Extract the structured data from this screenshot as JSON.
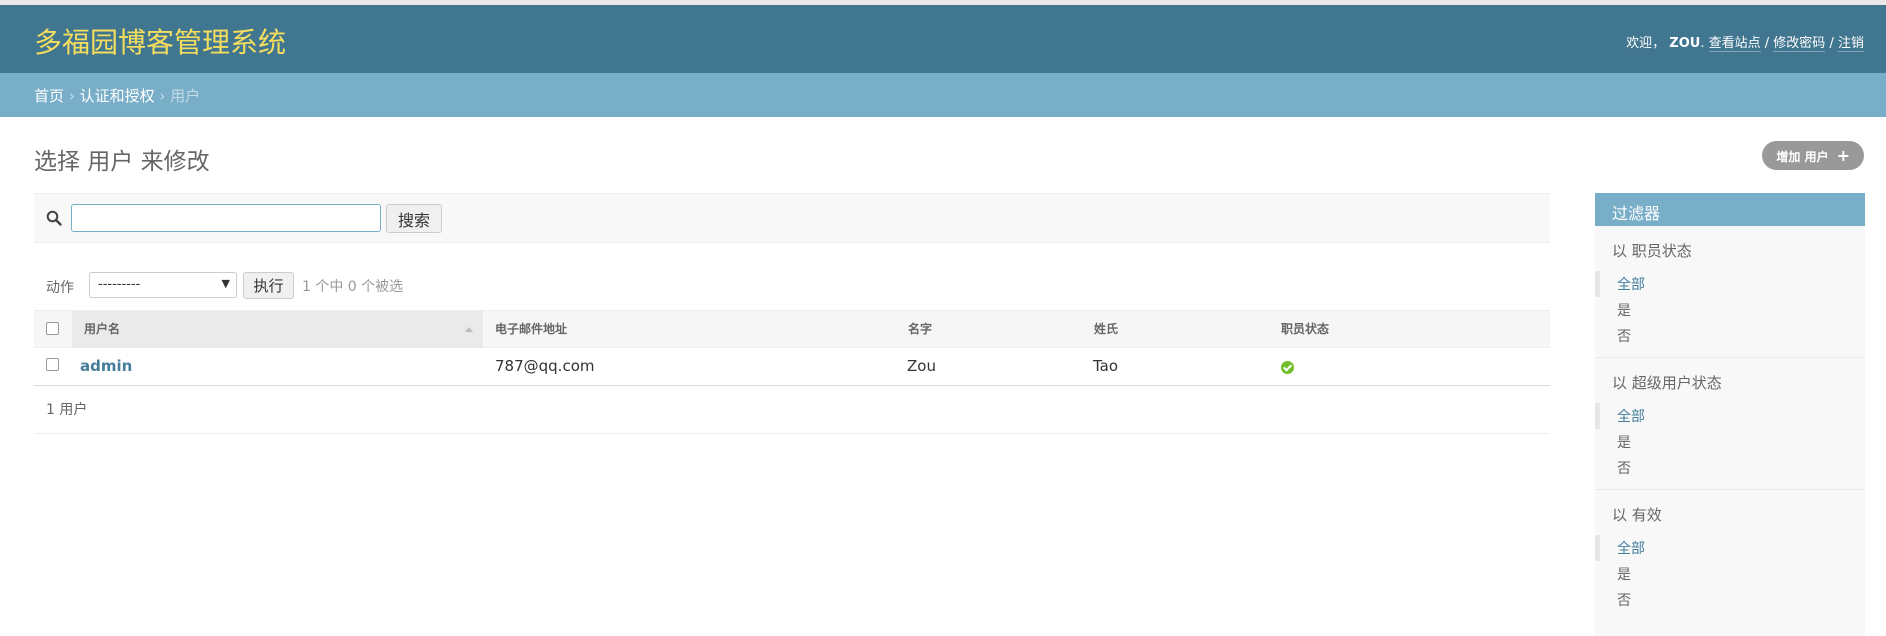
{
  "header": {
    "site_name": "多福园博客管理系统",
    "welcome": "欢迎，",
    "username": "ZOU",
    "view_site": "查看站点",
    "change_password": "修改密码",
    "logout": "注销",
    "sep": "/"
  },
  "breadcrumbs": {
    "home": "首页",
    "app": "认证和授权",
    "current": "用户",
    "sep": "›"
  },
  "page": {
    "title": "选择 用户 来修改",
    "add_button": "增加 用户",
    "add_icon": "+"
  },
  "search": {
    "value": "",
    "placeholder": "",
    "button": "搜索"
  },
  "actions": {
    "label": "动作",
    "selected": "---------",
    "go_button": "执行",
    "counter": "1 个中 0 个被选"
  },
  "table": {
    "headers": [
      "用户名",
      "电子邮件地址",
      "名字",
      "姓氏",
      "职员状态"
    ],
    "rows": [
      {
        "username": "admin",
        "email": "787@qq.com",
        "first_name": "Zou",
        "last_name": "Tao",
        "is_staff": true
      }
    ]
  },
  "paginator": {
    "text": "1 用户"
  },
  "filter": {
    "title": "过滤器",
    "groups": [
      {
        "title": "以 职员状态",
        "options": [
          "全部",
          "是",
          "否"
        ],
        "selected": 0
      },
      {
        "title": "以 超级用户状态",
        "options": [
          "全部",
          "是",
          "否"
        ],
        "selected": 0
      },
      {
        "title": "以 有效",
        "options": [
          "全部",
          "是",
          "否"
        ],
        "selected": 0
      }
    ]
  },
  "colors": {
    "header": "#417690",
    "breadcrumbs": "#79aec8",
    "site_name": "#f5dd5d",
    "link": "#447e9b",
    "status_true": "#70bf2b"
  }
}
